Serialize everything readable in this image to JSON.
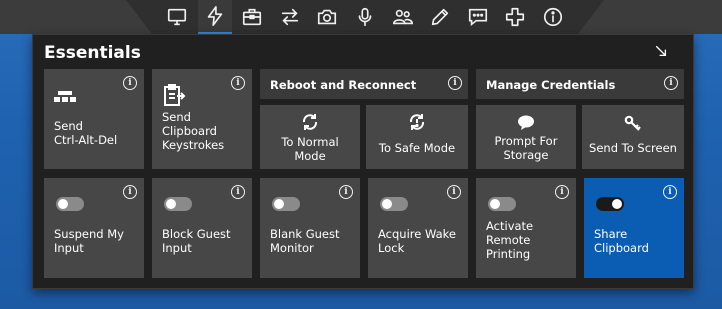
{
  "toolbar": {
    "icons": [
      "display-icon",
      "lightning-icon",
      "toolbox-icon",
      "transfer-arrows-icon",
      "camera-icon",
      "microphone-icon",
      "users-icon",
      "pencil-icon",
      "chat-icon",
      "plus-icon",
      "info-icon"
    ],
    "active_index": 1,
    "accent_color": "#2b86d8"
  },
  "panel": {
    "title": "Essentials",
    "tiles_row1": {
      "send_cad": {
        "label": "Send\nCtrl-Alt-Del",
        "icon": "keyboard-keys-icon"
      },
      "send_clipboard": {
        "label": "Send\nClipboard\nKeystrokes",
        "icon": "clipboard-icon"
      },
      "reboot_group": {
        "title": "Reboot and Reconnect",
        "normal": {
          "label": "To Normal\nMode",
          "icon": "reload-icon"
        },
        "safe": {
          "label": "To Safe Mode",
          "icon": "reload-safe-icon"
        }
      },
      "credentials_group": {
        "title": "Manage Credentials",
        "prompt": {
          "label": "Prompt For\nStorage",
          "icon": "speech-bubble-icon"
        },
        "send": {
          "label": "Send To Screen",
          "icon": "key-icon"
        }
      }
    },
    "tiles_row2": [
      {
        "label": "Suspend My\nInput",
        "on": false
      },
      {
        "label": "Block Guest\nInput",
        "on": false
      },
      {
        "label": "Blank Guest\nMonitor",
        "on": false
      },
      {
        "label": "Acquire Wake\nLock",
        "on": false
      },
      {
        "label": "Activate\nRemote\nPrinting",
        "on": false
      },
      {
        "label": "Share\nClipboard",
        "on": true
      }
    ],
    "colors": {
      "tile": "#474747",
      "tile_on": "#0b5cb3",
      "panel_bg": "#202020"
    }
  }
}
